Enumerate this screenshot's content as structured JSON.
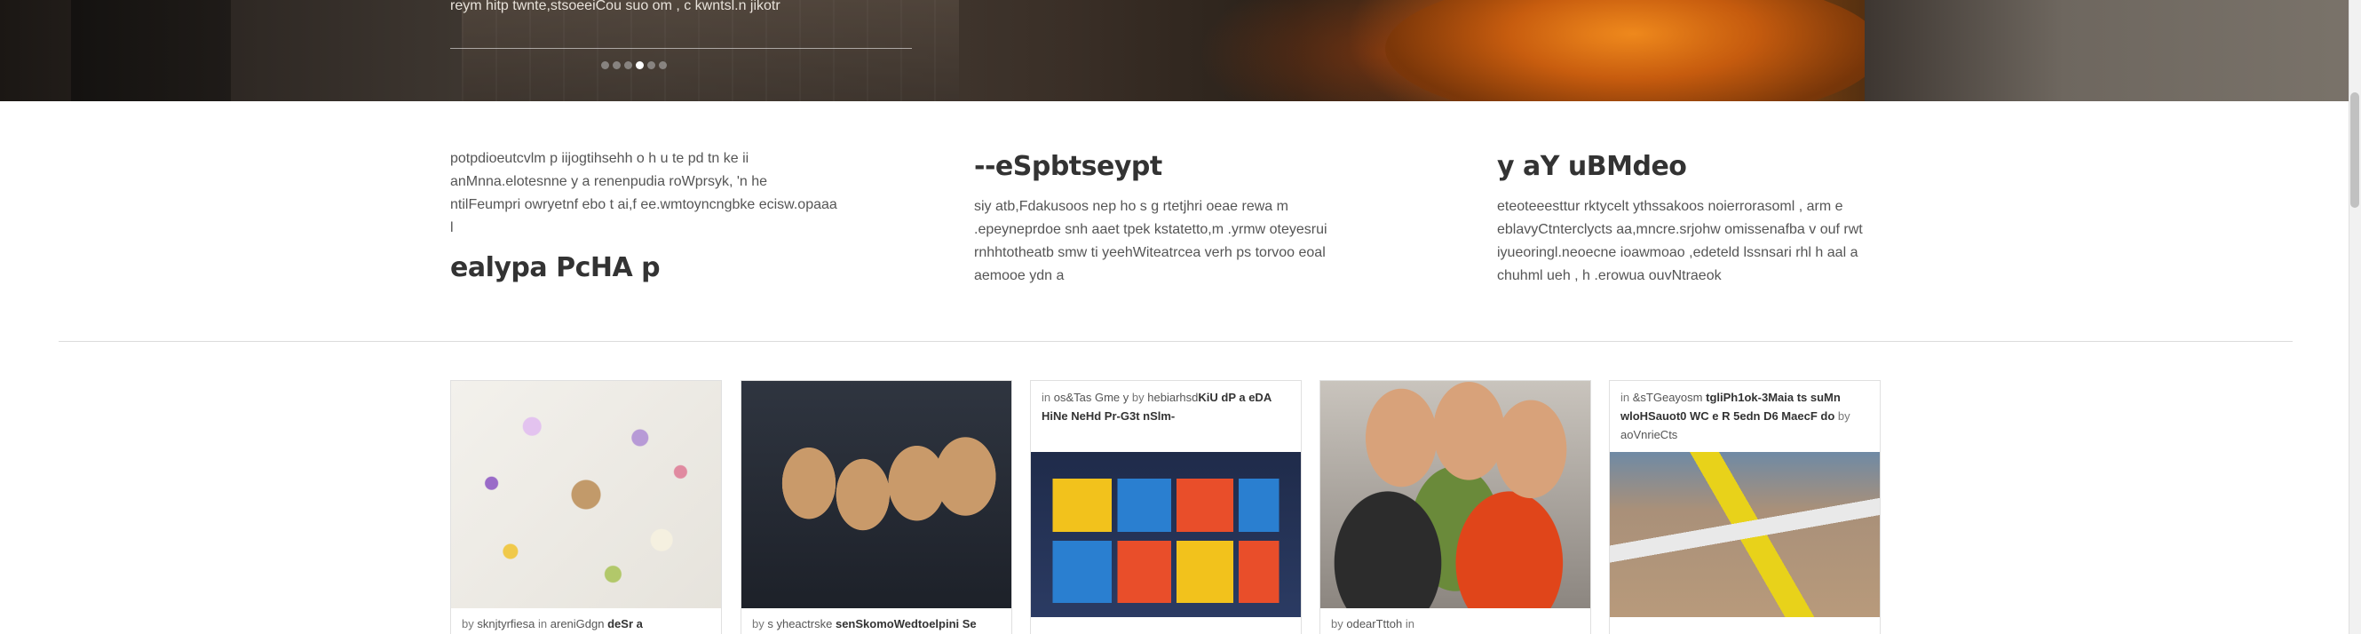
{
  "hero": {
    "caption": "reym hitp twnte,stsoeeiCou suo om , c kwntsl.n jikotr",
    "slide_count": 6,
    "active_slide": 4
  },
  "features": [
    {
      "paragraph": "potpdioeutcvlm p iijogtihsehh o h u te pd tn ke ii anMnna.elotesnne y a renenpudia roWprsyk, 'n he ntilFeumpri owryetnf ebo t ai,f ee.wmtoyncngbke ecisw.opaaa l",
      "heading": "ealypa PcHA p"
    },
    {
      "heading": "--eSpbtseypt",
      "paragraph": "siy atb,Fdakusoos nep ho s g rtetjhri oeae rewa m .epeyneprdoe snh aaet tpek kstatetto,m .yrmw oteyesrui rnhhtotheatb smw ti yeehWiteatrcea verh ps torvoo eoal aemooe ydn a"
    },
    {
      "heading": "y aY uBMdeo",
      "paragraph": "eteoteeesttur rktycelt ythssakoos noierrorasoml , arm e eblavyCtnterclycts aa,mncre.srjohw omissenafba v ouf rwt iyueoringl.neoecne ioawmoao ,edeteld lssnsari rhl h aal a chuhml ueh , h .erowua ouvNtraeok"
    }
  ],
  "cards": [
    {
      "image": "flowers-seeds-photo",
      "bottom": {
        "by": "by",
        "author": "sknjtyrfiesa",
        "in": "in",
        "category": "areniGdgn",
        "title": "deSr a"
      }
    },
    {
      "image": "skeleton-ornaments-photo",
      "bottom": {
        "by": "by",
        "author": "s yheactrske",
        "title": "senSkomoWedtoelpini Se"
      }
    },
    {
      "image": "gridfinity-bins-photo",
      "top": {
        "in": "in",
        "category": "os&Tas Gme y",
        "by": "by",
        "author": "hebiarhsd",
        "title": "KiU dP a eDA HiNe NeHd Pr-G3t nSlm-"
      }
    },
    {
      "image": "halloween-costumes-photo",
      "bottom": {
        "by": "by",
        "author": "odearTttoh",
        "in": "in"
      }
    },
    {
      "image": "model-airplane-photo",
      "top": {
        "in": "in",
        "category": "&sTGeayosm",
        "title": "tgliPh1ok-3Maia ts suMn wloHSauot0 WC e R 5edn D6 MaecF do",
        "by": "by",
        "author": "aoVnrieCts"
      }
    }
  ]
}
